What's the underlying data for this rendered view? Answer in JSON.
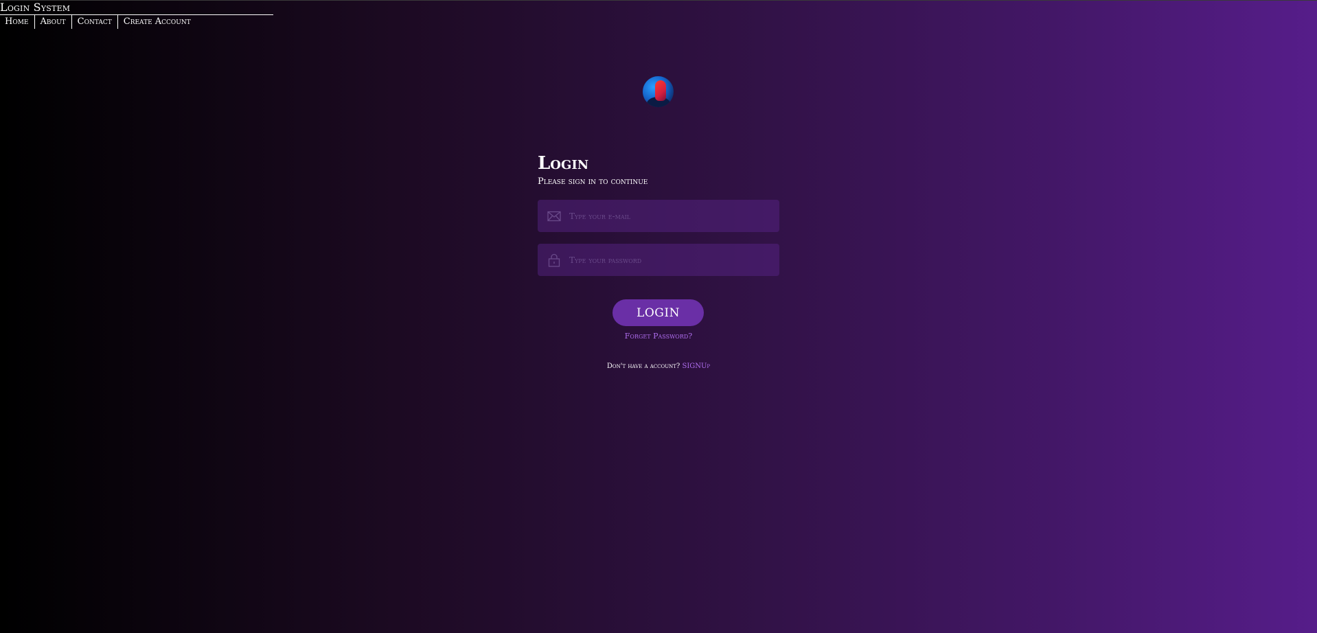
{
  "header": {
    "brand": "Login System",
    "nav": [
      {
        "label": "Home"
      },
      {
        "label": "About"
      },
      {
        "label": "Contact"
      },
      {
        "label": "Create Account"
      }
    ]
  },
  "login": {
    "title": "Login",
    "subtitle": "Please sign in to continue",
    "email_placeholder": "Type your e-mail",
    "password_placeholder": "Type your password",
    "button_label": "LOGIN",
    "forget_label": "Forget Password?",
    "signup_prompt": "Don't have a account?",
    "signup_label": "SIGNUp"
  },
  "icons": {
    "email": "envelope-icon",
    "password": "lock-icon"
  },
  "colors": {
    "accent": "#b06ef0",
    "button": "#6a2fa6",
    "field_bg": "#3a1a5a"
  }
}
